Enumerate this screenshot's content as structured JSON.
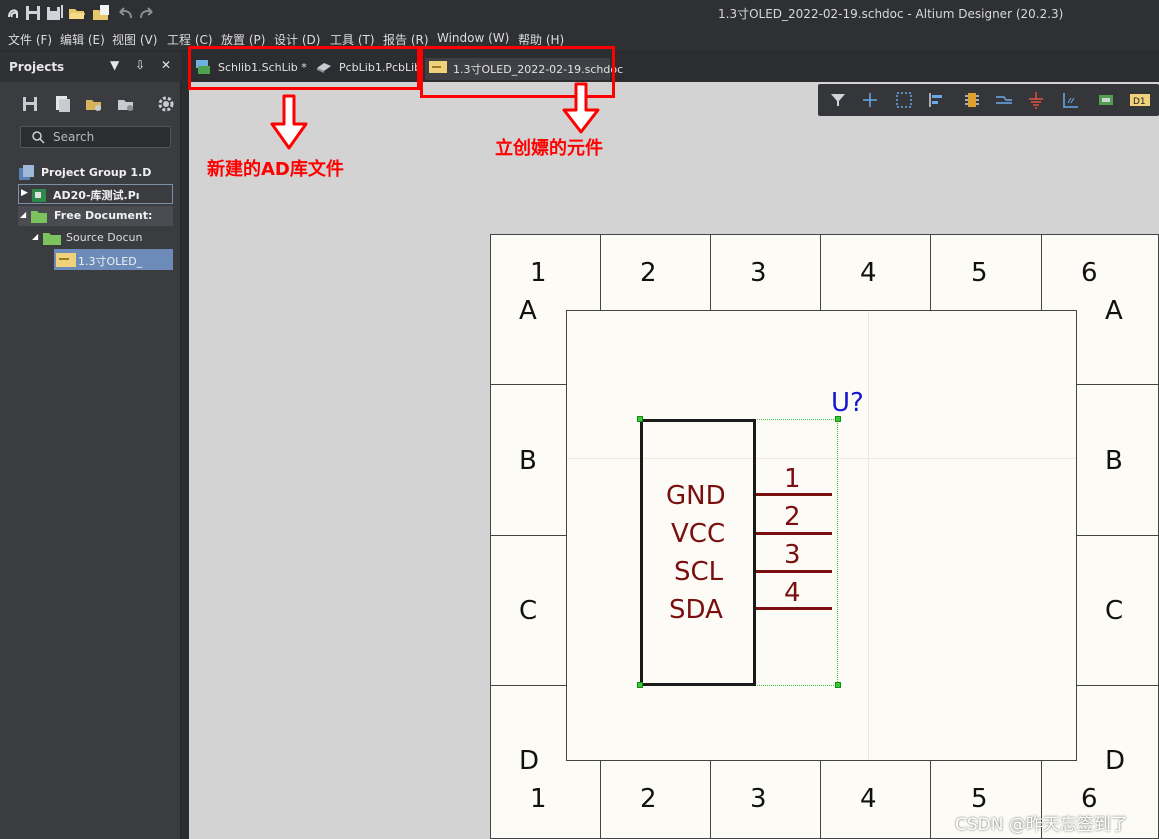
{
  "window": {
    "title": "1.3寸OLED_2022-02-19.schdoc - Altium Designer (20.2.3)"
  },
  "menu": [
    "文件 (F)",
    "编辑 (E)",
    "视图 (V)",
    "工程 (C)",
    "放置 (P)",
    "设计 (D)",
    "工具 (T)",
    "报告 (R)",
    "Window (W)",
    "帮助 (H)"
  ],
  "panel": {
    "title": "Projects",
    "header_buttons": "▼ ⇩ ✕",
    "search_placeholder": "Search",
    "tree": {
      "project_group": "Project Group 1.D",
      "project": "AD20-库测试.Pı",
      "free_documents": "Free Document:",
      "source_documents": "Source Docun",
      "document": "1.3寸OLED_"
    }
  },
  "tabs": [
    "Schlib1.SchLib *",
    "PcbLib1.PcbLib",
    "1.3寸OLED_2022-02-19.schdoc"
  ],
  "sheet": {
    "columns": [
      "1",
      "2",
      "3",
      "4",
      "5",
      "6"
    ],
    "rows": [
      "A",
      "B",
      "C",
      "D"
    ]
  },
  "component": {
    "designator": "U?",
    "pins": [
      {
        "number": "1",
        "name": "GND"
      },
      {
        "number": "2",
        "name": "VCC"
      },
      {
        "number": "3",
        "name": "SCL"
      },
      {
        "number": "4",
        "name": "SDA"
      }
    ]
  },
  "annotations": {
    "left_label": "新建的AD库文件",
    "right_label": "立创嫖的元件"
  },
  "watermark": "CSDN @昨天忘签到了",
  "colors": {
    "annotation": "#ff0000",
    "pin": "#7a0f0f",
    "designator": "#1515d0",
    "selection": "#33cc33"
  }
}
